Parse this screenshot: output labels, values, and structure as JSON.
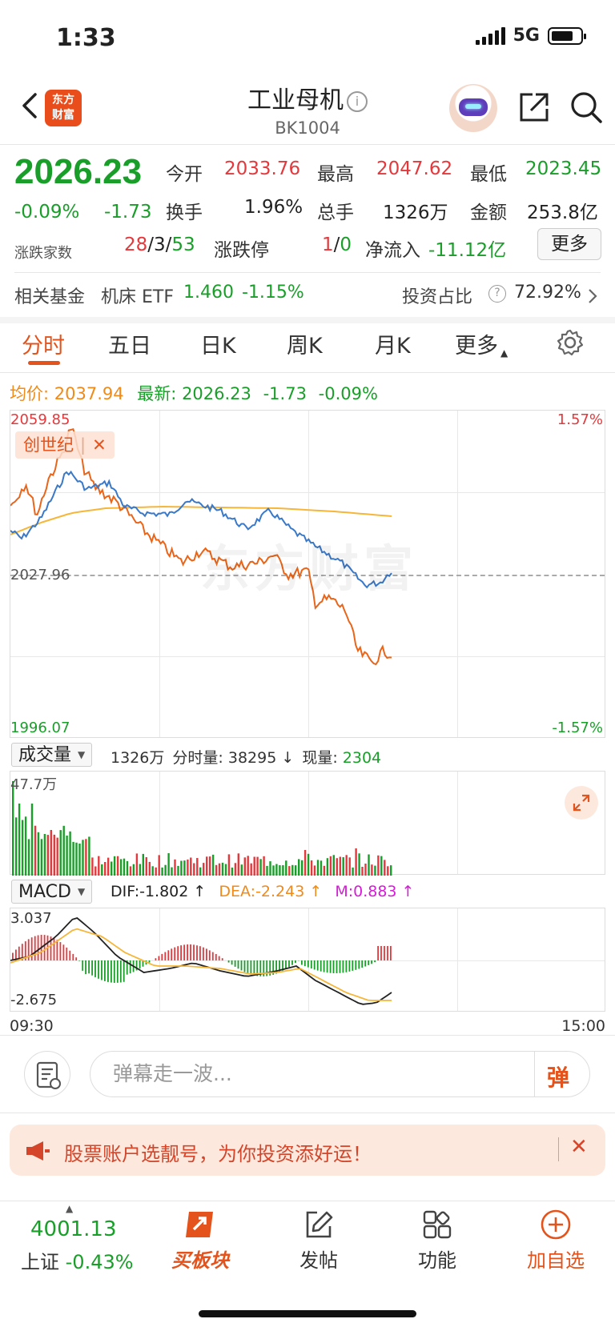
{
  "status": {
    "time": "1:33",
    "network": "5G"
  },
  "header": {
    "brand_line1": "东方",
    "brand_line2": "财富",
    "title": "工业母机",
    "code": "BK1004"
  },
  "quote": {
    "price": "2026.23",
    "change_pct": "-0.09%",
    "change": "-1.73",
    "open_label": "今开",
    "open": "2033.76",
    "high_label": "最高",
    "high": "2047.62",
    "low_label": "最低",
    "low": "2023.45",
    "turnover_label": "换手",
    "turnover": "1.96%",
    "volume_label": "总手",
    "volume": "1326万",
    "amount_label": "金额",
    "amount": "253.8亿",
    "breadth_label": "涨跌家数",
    "breadth_up": "28",
    "breadth_flat": "3",
    "breadth_down": "53",
    "limit_label": "涨跌停",
    "limit_up": "1",
    "limit_down": "0",
    "inflow_label": "净流入",
    "inflow": "-11.12亿",
    "more_label": "更多"
  },
  "fund": {
    "label": "相关基金",
    "name": "机床 ETF",
    "price": "1.460",
    "pct": "-1.15%",
    "ratio_label": "投资占比",
    "ratio": "72.92%"
  },
  "tabs": [
    "分时",
    "五日",
    "日K",
    "周K",
    "月K",
    "更多"
  ],
  "intraday": {
    "avg_label": "均价:",
    "avg": "2037.94",
    "last_label": "最新:",
    "last": "2026.23",
    "last_chg": "-1.73",
    "last_pct": "-0.09%",
    "y_top": "2059.85",
    "y_mid": "2027.96",
    "y_bottom": "1996.07",
    "pct_top": "1.57%",
    "pct_bottom": "-1.57%",
    "compare_tag": "创世纪",
    "watermark": "东方财富"
  },
  "volume": {
    "selector": "成交量",
    "total": "1326万",
    "tick_label": "分时量:",
    "tick": "38295",
    "tick_arrow": "↓",
    "now_label": "现量:",
    "now": "2304",
    "max_label": "47.7万"
  },
  "macd": {
    "selector": "MACD",
    "dif": "DIF:-1.802 ↑",
    "dea": "DEA:-2.243 ↑",
    "m": "M:0.883 ↑",
    "y_top": "3.037",
    "y_bottom": "-2.675",
    "t_start": "09:30",
    "t_end": "15:00"
  },
  "comment": {
    "placeholder": "弹幕走一波...",
    "dan": "弹"
  },
  "banner": {
    "text": "股票账户选靓号，为你投资添好运！"
  },
  "bottom_nav": {
    "index_value": "4001.13",
    "index_name": "上证",
    "index_pct": "-0.43%",
    "items": [
      "买板块",
      "发帖",
      "功能",
      "加自选"
    ]
  },
  "colors": {
    "up": "#e4393c",
    "down": "#1a9e2a",
    "accent": "#e4531b",
    "price_line": "#3a78c8",
    "avg_line": "#f5b63a",
    "compare_line": "#e8651a"
  }
}
